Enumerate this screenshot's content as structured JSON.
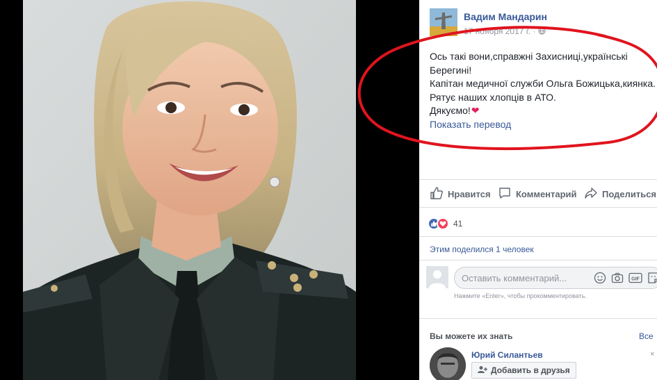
{
  "post": {
    "author": "Вадим Мандарин",
    "date": "17 ноября 2017 г. · ",
    "text_lines": [
      "Ось такі вони,справжні Захисниці,українські",
      "Берегині!",
      "Капітан медичної служби Ольга Божицька,киянка.",
      "Рятує наших хлопців в АТО.",
      "Дякуємо!"
    ],
    "heart_glyph": "❤",
    "translate_link": "Показать перевод"
  },
  "actions": {
    "like": "Нравится",
    "comment": "Комментарий",
    "share": "Поделиться"
  },
  "reactions": {
    "count": "41",
    "like_icon": "like-icon",
    "love_icon": "heart-icon"
  },
  "shares": "Этим поделился 1 человек",
  "comment": {
    "placeholder": "Оставить комментарий...",
    "hint": "Нажмите «Enter», чтобы прокомментировать.",
    "icons": [
      "emoji-icon",
      "camera-icon",
      "gif-icon",
      "sticker-icon"
    ]
  },
  "pymk": {
    "title": "Вы можете их знать",
    "see_all": "Все",
    "person_name": "Юрий Силантьев",
    "add_friend": "Добавить в друзья",
    "close_glyph": "×"
  },
  "colors": {
    "link": "#385898",
    "annotation_ellipse": "#e0141e",
    "like_blue": "#4267b2",
    "love_red": "#f33e58"
  }
}
